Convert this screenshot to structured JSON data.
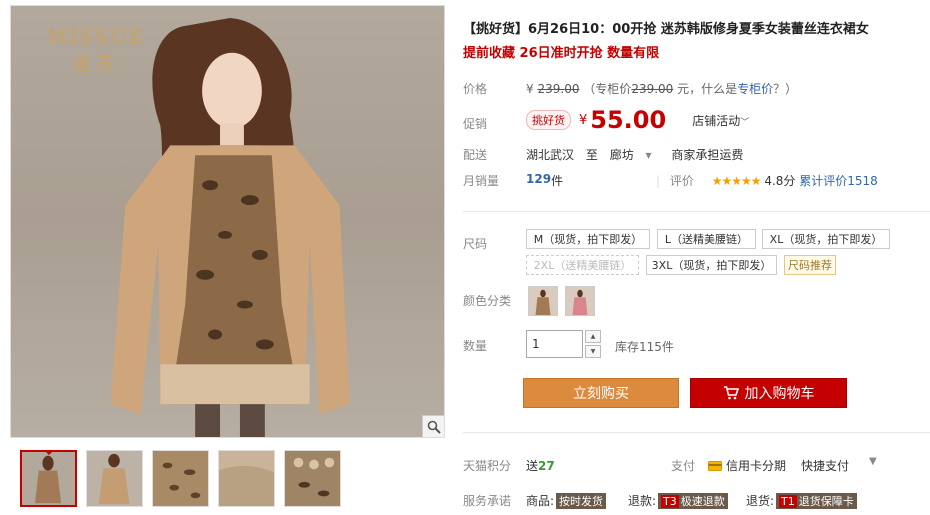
{
  "brand": {
    "en": "MISSUE",
    "cn": "迷苏"
  },
  "icons": {
    "zoom": "magnifier-icon",
    "cart": "cart-icon",
    "card": "credit-card-icon"
  },
  "colors": {
    "accent": "#c40000",
    "buy": "#dc8a3d",
    "green": "#3a9a3a",
    "link": "#3366aa"
  },
  "product": {
    "title": "【挑好货】6月26日10：00开抢 迷苏韩版修身夏季女装蕾丝连衣裙女",
    "subtitle": "提前收藏 26日准时开抢 数量有限"
  },
  "price": {
    "label": "价格",
    "yen": "¥",
    "original": "239.00",
    "counter_prefix": "（专柜价",
    "counter": "239.00",
    "counter_suffix": " 元，什么是",
    "counter_link": "专柜价",
    "counter_end": "？）"
  },
  "promo": {
    "label": "促销",
    "tag": "挑好货",
    "yen": "¥",
    "value": "55.00",
    "store_activity": "店铺活动",
    "store_arrow": "﹀"
  },
  "shipping": {
    "label": "配送",
    "from": "湖北武汉",
    "to_word": "至",
    "to": "廊坊",
    "arrow": "▾",
    "fee": "商家承担运费"
  },
  "sales": {
    "label": "月销量",
    "count": "129",
    "unit": "件",
    "rating_label": "评价",
    "stars": "★★★★★",
    "score": "4.8分",
    "reviews": "累计评价1518"
  },
  "size": {
    "label": "尺码",
    "options": [
      "M（现货，拍下即发）",
      "L（送精美腰链）",
      "XL（现货，拍下即发）",
      "2XL（送精美腰链）",
      "3XL（现货，拍下即发）",
      "尺码推荐"
    ]
  },
  "color": {
    "label": "颜色分类"
  },
  "quantity": {
    "label": "数量",
    "value": "1",
    "stock": "库存115件",
    "up": "▲",
    "down": "▼"
  },
  "actions": {
    "buy": "立刻购买",
    "cart": "加入购物车"
  },
  "points": {
    "label": "天猫积分",
    "prefix": "送",
    "value": "27"
  },
  "payment": {
    "label": "支付",
    "card": "信用卡分期",
    "quick": "快捷支付",
    "arrow": "▼"
  },
  "service": {
    "label": "服务承诺",
    "items": [
      {
        "prefix": "商品:",
        "code": "",
        "text": "按时发货"
      },
      {
        "prefix": "退款:",
        "code": "T3",
        "text": "极速退款"
      },
      {
        "prefix": "退货:",
        "code": "T1",
        "text": "退货保障卡"
      }
    ]
  }
}
